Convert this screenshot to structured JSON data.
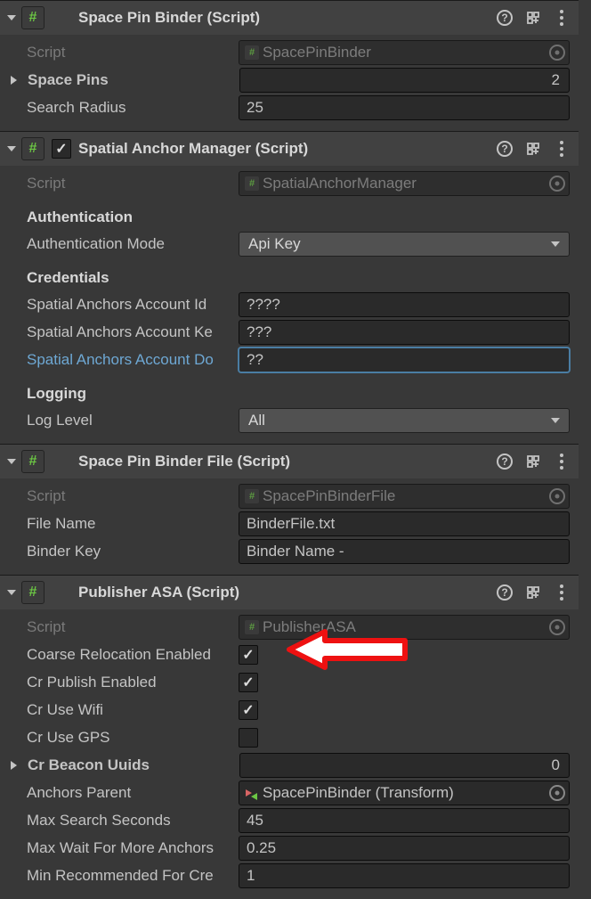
{
  "c1": {
    "title": "Space Pin Binder (Script)",
    "script_label": "Script",
    "script_value": "SpacePinBinder",
    "space_pins_label": "Space Pins",
    "space_pins_value": "2",
    "search_radius_label": "Search Radius",
    "search_radius_value": "25"
  },
  "c2": {
    "title": "Spatial Anchor Manager (Script)",
    "enabled": true,
    "script_label": "Script",
    "script_value": "SpatialAnchorManager",
    "auth_heading": "Authentication",
    "auth_mode_label": "Authentication Mode",
    "auth_mode_value": "Api Key",
    "cred_heading": "Credentials",
    "acct_id_label": "Spatial Anchors Account Id",
    "acct_id_value": "????",
    "acct_key_label": "Spatial Anchors Account Ke",
    "acct_key_value": "???",
    "acct_dom_label": "Spatial Anchors Account Do",
    "acct_dom_value": "??",
    "log_heading": "Logging",
    "log_level_label": "Log Level",
    "log_level_value": "All"
  },
  "c3": {
    "title": "Space Pin Binder File (Script)",
    "script_label": "Script",
    "script_value": "SpacePinBinderFile",
    "file_name_label": "File Name",
    "file_name_value": "BinderFile.txt",
    "binder_key_label": "Binder Key",
    "binder_key_value": "Binder Name -"
  },
  "c4": {
    "title": "Publisher ASA (Script)",
    "script_label": "Script",
    "script_value": "PublisherASA",
    "coarse_label": "Coarse Relocation Enabled",
    "coarse_checked": true,
    "cr_publish_label": "Cr Publish Enabled",
    "cr_publish_checked": true,
    "cr_wifi_label": "Cr Use Wifi",
    "cr_wifi_checked": true,
    "cr_gps_label": "Cr Use GPS",
    "cr_gps_checked": false,
    "beacon_label": "Cr Beacon Uuids",
    "beacon_value": "0",
    "anchors_parent_label": "Anchors Parent",
    "anchors_parent_value": "SpacePinBinder (Transform)",
    "max_search_label": "Max Search Seconds",
    "max_search_value": "45",
    "max_wait_label": "Max Wait For More Anchors",
    "max_wait_value": "0.25",
    "min_rec_label": "Min Recommended For Cre",
    "min_rec_value": "1"
  }
}
